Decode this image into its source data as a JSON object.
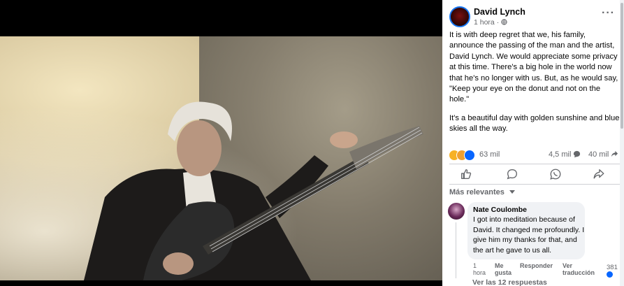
{
  "post": {
    "author": "David Lynch",
    "time": "1 hora",
    "paragraph1": "It is with deep regret that we, his family, announce the passing of the man and the artist, David Lynch. We would appreciate some privacy at this time. There's a big hole in the world now that he's no longer with us. But, as he would say, \"Keep your eye on the donut and not on the hole.\"",
    "paragraph2": "It's a beautiful day with golden sunshine and blue skies all the way.",
    "reactions_count": "63 mil",
    "comments_count": "4,5 mil",
    "shares_count": "40 mil"
  },
  "sort_label": "Más relevantes",
  "comment": {
    "author": "Nate Coulombe",
    "text": "I got into meditation because of David. It changed me profoundly. I give him my thanks for that, and the art he gave to us all.",
    "time": "1 hora",
    "like_label": "Me gusta",
    "reply_label": "Responder",
    "translate_label": "Ver traducción",
    "reaction_count": "381",
    "replies_label": "Ver las 12 respuestas"
  },
  "colors": {
    "accent": "#0866ff",
    "secondary_text": "#65676b",
    "bubble": "#f0f2f5"
  }
}
